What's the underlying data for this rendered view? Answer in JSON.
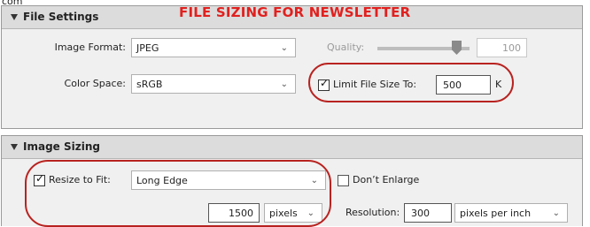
{
  "top_fragment": "com",
  "annotation": {
    "title": "FILE SIZING FOR NEWSLETTER",
    "color": "#e0211f",
    "ring_color": "#b82320"
  },
  "file_settings": {
    "header": "File Settings",
    "image_format": {
      "label": "Image Format:",
      "value": "JPEG"
    },
    "quality": {
      "label": "Quality:",
      "value": "100",
      "level": 1.0
    },
    "color_space": {
      "label": "Color Space:",
      "value": "sRGB"
    },
    "limit_file_size": {
      "label": "Limit File Size To:",
      "checked": true,
      "value": "500",
      "unit": "K"
    }
  },
  "image_sizing": {
    "header": "Image Sizing",
    "resize_to_fit": {
      "label": "Resize to Fit:",
      "checked": true,
      "value": "Long Edge"
    },
    "dont_enlarge": {
      "label": "Don’t Enlarge",
      "checked": false
    },
    "size": {
      "value": "1500",
      "unit": "pixels"
    },
    "resolution": {
      "label": "Resolution:",
      "value": "300",
      "unit": "pixels per inch"
    }
  },
  "icons": {
    "dropdown": "chevron-down-icon",
    "section_toggle": "triangle-down-icon",
    "check": "checkmark-icon"
  }
}
